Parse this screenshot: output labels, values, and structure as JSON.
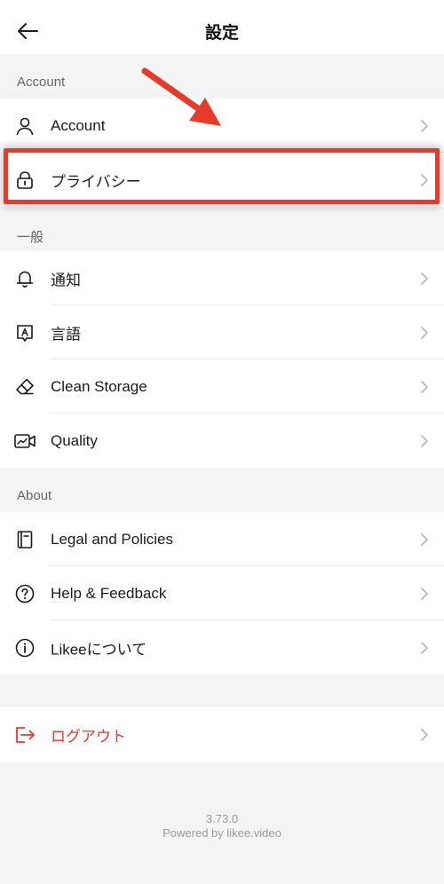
{
  "header": {
    "title": "設定",
    "back_icon": "arrow-left-icon"
  },
  "sections": {
    "account_label": "Account",
    "general_label": "一般",
    "about_label": "About"
  },
  "account_items": [
    {
      "label": "Account",
      "icon": "person-icon"
    },
    {
      "label": "プライバシー",
      "icon": "lock-icon"
    }
  ],
  "general_items": [
    {
      "label": "通知",
      "icon": "bell-icon"
    },
    {
      "label": "言語",
      "icon": "language-icon"
    },
    {
      "label": "Clean Storage",
      "icon": "eraser-icon"
    },
    {
      "label": "Quality",
      "icon": "video-quality-icon"
    }
  ],
  "about_items": [
    {
      "label": "Legal and Policies",
      "icon": "book-icon"
    },
    {
      "label": "Help & Feedback",
      "icon": "question-icon"
    },
    {
      "label": "Likeeについて",
      "icon": "info-icon"
    }
  ],
  "logout": {
    "label": "ログアウト",
    "icon": "logout-icon"
  },
  "footer": {
    "version": "3.73.0",
    "powered_by": "Powered by likee.video"
  },
  "colors": {
    "accent_red": "#e5382f",
    "annotation_red": "#e63a2a",
    "background": "#f4f4f4"
  }
}
